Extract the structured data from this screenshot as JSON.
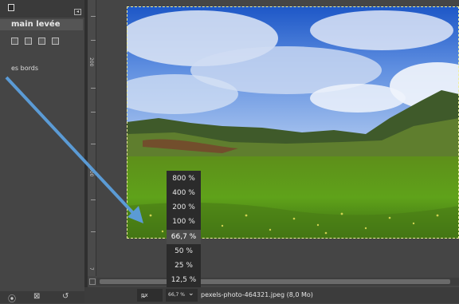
{
  "tool_options": {
    "title": "main levée",
    "feather_label": "es bords",
    "mode_icons": [
      "replace-mode-icon",
      "add-mode-icon",
      "subtract-mode-icon",
      "intersect-mode-icon"
    ]
  },
  "status": {
    "unit": "px",
    "zoom": "66,7 %",
    "file": "pexels-photo-464321.jpeg (8,0 Mo)"
  },
  "zoom_menu": {
    "options": [
      "800 %",
      "400 %",
      "200 %",
      "100 %",
      "66,7 %",
      "50 %",
      "25 %",
      "12,5 %"
    ],
    "selected": "66,7 %"
  },
  "ruler": {
    "marks": [
      "200",
      "400",
      "7"
    ]
  },
  "colors": {
    "accent_arrow": "#5b9bd5",
    "selection_dash": "#f0f0a0"
  }
}
